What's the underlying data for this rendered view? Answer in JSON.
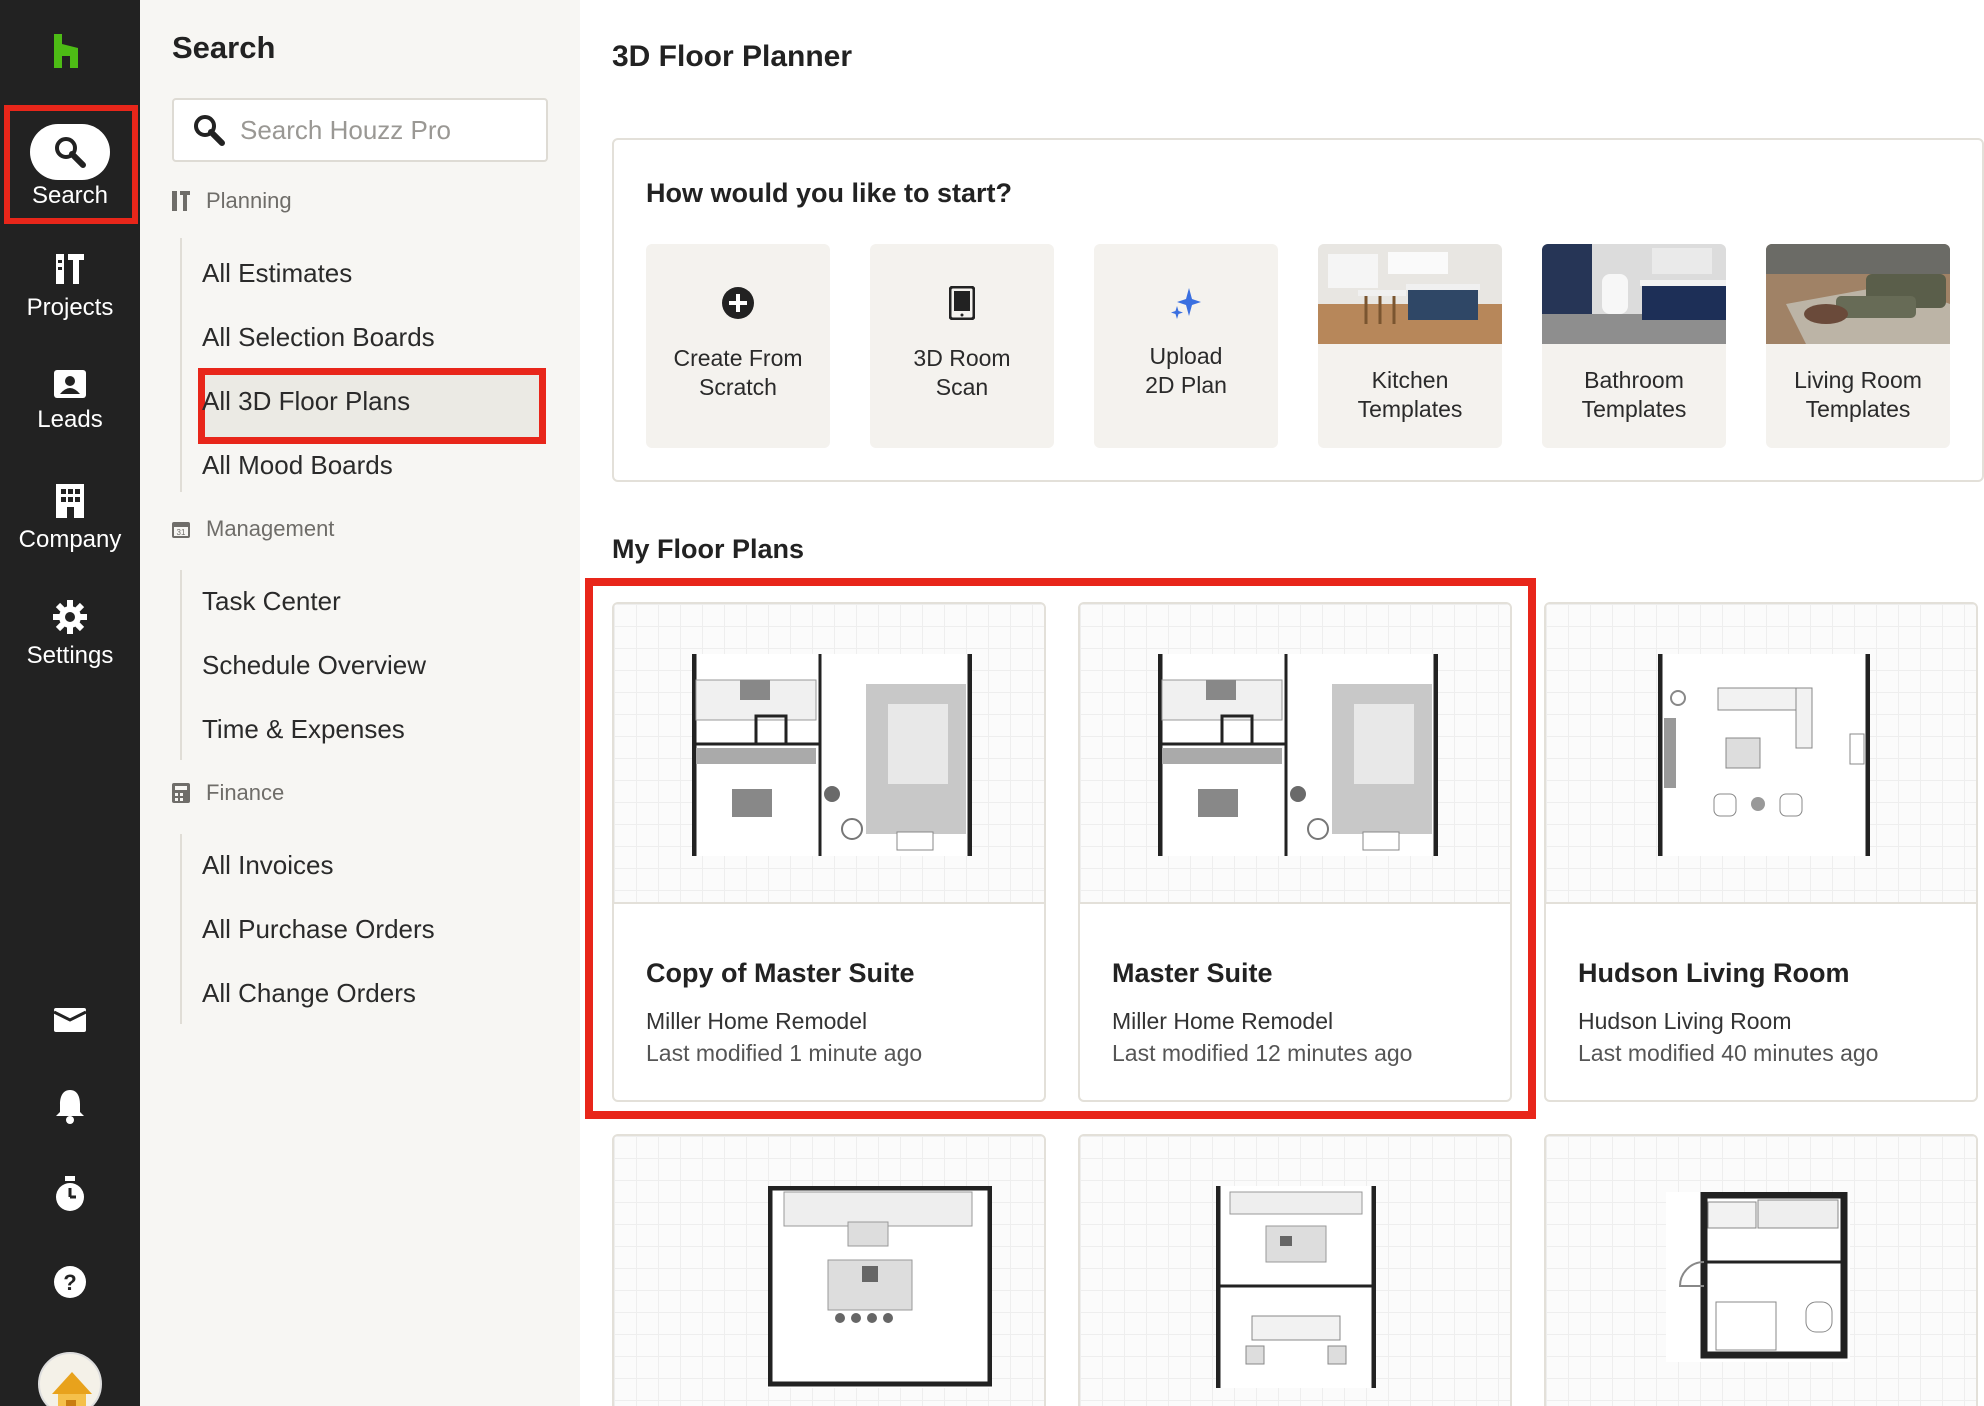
{
  "rail": {
    "items": [
      {
        "label": "Search",
        "icon": "search-icon"
      },
      {
        "label": "Projects",
        "icon": "projects-icon"
      },
      {
        "label": "Leads",
        "icon": "leads-icon"
      },
      {
        "label": "Company",
        "icon": "company-icon"
      },
      {
        "label": "Settings",
        "icon": "gear-icon"
      }
    ],
    "utilities": [
      "inbox-icon",
      "bell-icon",
      "timer-icon",
      "help-icon"
    ],
    "brand_color": "#4dbc15",
    "highlight_color": "#e8261a"
  },
  "search_panel": {
    "title": "Search",
    "placeholder": "Search Houzz Pro",
    "sections": [
      {
        "label": "Planning",
        "icon": "planning-icon",
        "items": [
          "All Estimates",
          "All Selection Boards",
          "All 3D Floor Plans",
          "All Mood Boards"
        ]
      },
      {
        "label": "Management",
        "icon": "calendar-icon",
        "items": [
          "Task Center",
          "Schedule Overview",
          "Time & Expenses"
        ]
      },
      {
        "label": "Finance",
        "icon": "finance-icon",
        "items": [
          "All Invoices",
          "All Purchase Orders",
          "All Change Orders"
        ]
      }
    ],
    "active_item": "All 3D Floor Plans"
  },
  "main": {
    "title": "3D Floor Planner",
    "start_prompt": "How would you like to start?",
    "start_options": [
      {
        "label": "Create From\nScratch",
        "icon": "plus-circle-icon"
      },
      {
        "label": "3D Room\nScan",
        "icon": "phone-icon"
      },
      {
        "label": "Upload\n2D Plan",
        "icon": "sparkle-icon"
      },
      {
        "label": "Kitchen\nTemplates",
        "icon": "kitchen-image"
      },
      {
        "label": "Bathroom\nTemplates",
        "icon": "bathroom-image"
      },
      {
        "label": "Living Room\nTemplates",
        "icon": "living-room-image"
      }
    ],
    "plans_title": "My Floor Plans",
    "plans": [
      {
        "name": "Copy of Master Suite",
        "project": "Miller Home Remodel",
        "modified": "Last modified 1 minute ago"
      },
      {
        "name": "Master Suite",
        "project": "Miller Home Remodel",
        "modified": "Last modified 12 minutes ago"
      },
      {
        "name": "Hudson Living Room",
        "project": "Hudson Living Room",
        "modified": "Last modified 40 minutes ago"
      },
      {
        "name": "",
        "project": "",
        "modified": ""
      },
      {
        "name": "",
        "project": "",
        "modified": ""
      },
      {
        "name": "",
        "project": "",
        "modified": ""
      }
    ]
  }
}
